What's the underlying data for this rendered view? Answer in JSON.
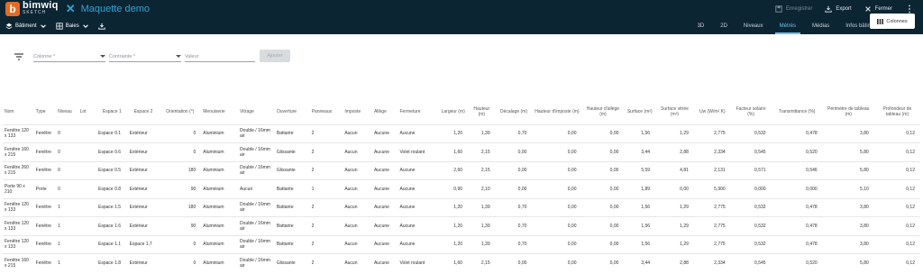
{
  "app": {
    "logo_letter": "b",
    "logo_name": "bimwiq",
    "logo_sub": "SKETCH",
    "close_symbol": "✕",
    "project_title": "Maquette demo"
  },
  "top_actions": {
    "save": "Enregistrer",
    "export": "Export",
    "close": "Fermer",
    "more": "⋮"
  },
  "nav": {
    "building": "Bâtiment",
    "bays": "Baies",
    "tabs": [
      "3D",
      "2D",
      "Niveaux",
      "Métrés",
      "Médias",
      "Infos bâtiment",
      "Caparol"
    ],
    "active_tab": "Métrés"
  },
  "filters": {
    "column_placeholder": "Colonne *",
    "constraint_placeholder": "Contrainte *",
    "value_placeholder": "Valeur",
    "apply_label": "Ajouter"
  },
  "columns_button": "Colonnes",
  "table": {
    "headers": [
      "Nom",
      "Type",
      "Niveau",
      "Lot",
      "Espace 1",
      "Espace 2",
      "Orientation (°)",
      "Menuiserie",
      "Vitrage",
      "Ouverture",
      "Panneaux",
      "Imposte",
      "Allège",
      "Fermeture",
      "Largeur (m)",
      "Hauteur (m)",
      "Décalage (m)",
      "Hauteur d'imposte (m)",
      "Hauteur d'allège (m)",
      "Surface (m²)",
      "Surface vitrée (m²)",
      "Uw (W/m².K)",
      "Facteur solaire (%)",
      "Transmittance (%)",
      "Périmètre de tableau (m)",
      "Profondeur de tableau (m)"
    ],
    "rows": [
      [
        "Fenêtre 120 x 133",
        "Fenêtre",
        "0",
        "",
        "Espace 0.1",
        "Extérieur",
        "0",
        "Aluminium",
        "Double / 16mm air",
        "Battante",
        "2",
        "Aucun",
        "Aucune",
        "Aucune",
        "1,20",
        "1,39",
        "0,70",
        "0,00",
        "0,00",
        "1,56",
        "1,29",
        "2,775",
        "0,532",
        "0,478",
        "3,80",
        "0,12"
      ],
      [
        "Fenêtre 160 x 215",
        "Fenêtre",
        "0",
        "",
        "Espace 0.6",
        "Extérieur",
        "0",
        "Aluminium",
        "Double / 16mm air",
        "Glissante",
        "2",
        "Aucun",
        "Aucune",
        "Volet roulant",
        "1,60",
        "2,15",
        "0,00",
        "0,00",
        "0,00",
        "3,44",
        "2,88",
        "2,334",
        "0,545",
        "0,520",
        "5,80",
        "0,12"
      ],
      [
        "Fenêtre 260 x 215",
        "Fenêtre",
        "0",
        "",
        "Espace 0.5",
        "Extérieur",
        "180",
        "Aluminium",
        "Double / 16mm air",
        "Glissante",
        "2",
        "Aucun",
        "Aucune",
        "Aucune",
        "2,60",
        "2,15",
        "0,00",
        "0,00",
        "0,00",
        "5,59",
        "4,81",
        "2,131",
        "0,571",
        "0,546",
        "5,80",
        "0,12"
      ],
      [
        "Porte 90 x 210",
        "Porte",
        "0",
        "",
        "Espace 0.8",
        "Extérieur",
        "90",
        "Aluminium",
        "Aucun",
        "Battante",
        "1",
        "Aucun",
        "Aucune",
        "Aucune",
        "0,90",
        "2,10",
        "0,00",
        "0,00",
        "0,00",
        "1,89",
        "0,00",
        "5,900",
        "0,000",
        "0,000",
        "5,10",
        "0,12"
      ],
      [
        "Fenêtre 120 x 133",
        "Fenêtre",
        "1",
        "",
        "Espace 1.5",
        "Extérieur",
        "180",
        "Aluminium",
        "Double / 16mm air",
        "Battante",
        "2",
        "Aucun",
        "Aucune",
        "Aucune",
        "1,20",
        "1,39",
        "0,70",
        "0,00",
        "0,00",
        "1,56",
        "1,29",
        "2,775",
        "0,532",
        "0,478",
        "3,80",
        "0,12"
      ],
      [
        "Fenêtre 120 x 133",
        "Fenêtre",
        "1",
        "",
        "Espace 1.6",
        "Extérieur",
        "90",
        "Aluminium",
        "Double / 16mm air",
        "Battante",
        "2",
        "Aucun",
        "Aucune",
        "Aucune",
        "1,20",
        "1,39",
        "0,70",
        "0,00",
        "0,00",
        "1,56",
        "1,29",
        "2,775",
        "0,532",
        "0,478",
        "3,80",
        "0,12"
      ],
      [
        "Fenêtre 120 x 133",
        "Fenêtre",
        "1",
        "",
        "Espace 1.1",
        "Espace 1.7",
        "0",
        "Aluminium",
        "Double / 16mm air",
        "Battante",
        "2",
        "Aucun",
        "Aucune",
        "Aucune",
        "1,20",
        "1,39",
        "0,70",
        "0,00",
        "0,00",
        "1,56",
        "1,29",
        "2,775",
        "0,532",
        "0,478",
        "3,80",
        "0,12"
      ],
      [
        "Fenêtre 160 x 215",
        "Fenêtre",
        "1",
        "",
        "Espace 1.8",
        "Extérieur",
        "0",
        "Aluminium",
        "Double / 16mm air",
        "Glissante",
        "2",
        "Aucun",
        "Aucune",
        "Volet roulant",
        "1,60",
        "2,15",
        "0,00",
        "0,00",
        "0,00",
        "3,44",
        "2,88",
        "2,334",
        "0,545",
        "0,520",
        "5,80",
        "0,12"
      ]
    ]
  },
  "colors": {
    "header_bg": "#0b2532",
    "accent": "#2fa4d8",
    "logo": "#e36b23",
    "active_tab": "#6cc3e8"
  }
}
